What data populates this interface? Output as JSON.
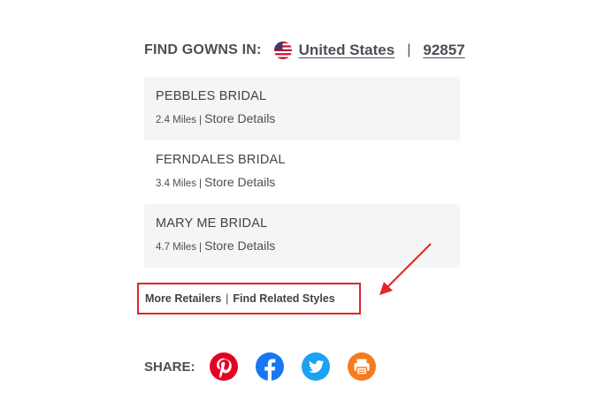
{
  "find": {
    "label": "FIND GOWNS IN:",
    "country": "United States",
    "separator": "|",
    "zip": "92857"
  },
  "stores": [
    {
      "name": "PEBBLES BRIDAL",
      "miles": "2.4 Miles",
      "sep": "|",
      "details": "Store Details"
    },
    {
      "name": "FERNDALES BRIDAL",
      "miles": "3.4 Miles",
      "sep": "|",
      "details": "Store Details"
    },
    {
      "name": "MARY ME BRIDAL",
      "miles": "4.7 Miles",
      "sep": "|",
      "details": "Store Details"
    }
  ],
  "links": {
    "more_retailers": "More Retailers",
    "sep": "|",
    "find_related": "Find Related Styles"
  },
  "share": {
    "label": "SHARE:",
    "icons": [
      "pinterest-icon",
      "facebook-icon",
      "twitter-icon",
      "print-icon"
    ]
  },
  "colors": {
    "highlight_border": "#e0262b",
    "pinterest": "#e60023",
    "facebook": "#1877f2",
    "twitter": "#1da1f2",
    "print": "#f47b20",
    "text": "#4a4f57",
    "row_shade": "#f5f5f5"
  }
}
